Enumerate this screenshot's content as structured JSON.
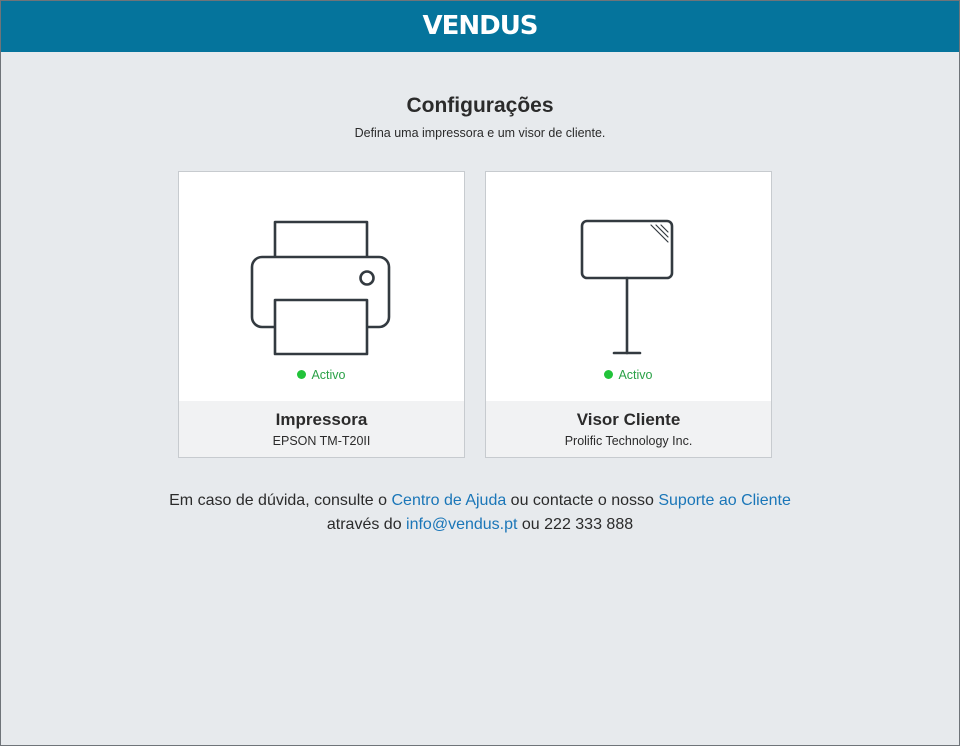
{
  "header": {
    "logo_text": "VENDUS",
    "brand_color": "#05749c"
  },
  "page": {
    "title": "Configurações",
    "subtitle": "Defina uma impressora e um visor de cliente."
  },
  "cards": [
    {
      "icon": "printer-icon",
      "status": "Activo",
      "status_color": "#22c33a",
      "name": "Impressora",
      "detail": "EPSON TM-T20II"
    },
    {
      "icon": "customer-display-icon",
      "status": "Activo",
      "status_color": "#22c33a",
      "name": "Visor Cliente",
      "detail": "Prolific Technology Inc."
    }
  ],
  "help": {
    "line1_prefix": "Em caso de dúvida, consulte o ",
    "help_center_link": "Centro de Ajuda",
    "line1_middle": " ou contacte o nosso ",
    "support_link": "Suporte ao Cliente",
    "line2_prefix": "através do ",
    "email_link": "info@vendus.pt",
    "line2_middle": " ou ",
    "phone": "222 333 888",
    "link_color": "#1a76b8"
  }
}
